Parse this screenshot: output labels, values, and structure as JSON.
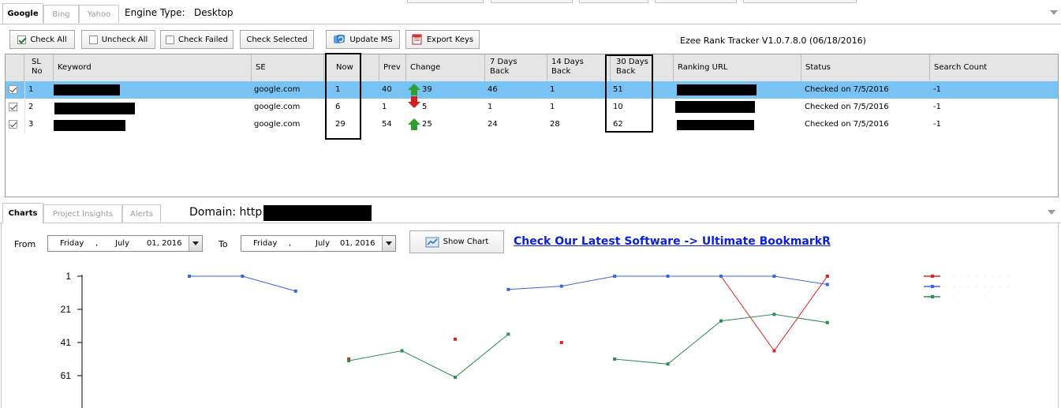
{
  "engine_tabs": [
    {
      "label": "Google",
      "active": true
    },
    {
      "label": "Bing",
      "active": false
    },
    {
      "label": "Yahoo",
      "active": false
    }
  ],
  "engine_type_label": "Engine Type:",
  "engine_type_value": "Desktop",
  "toolbar": {
    "check_all": "Check All",
    "uncheck_all": "Uncheck All",
    "check_failed": "Check Failed",
    "check_selected": "Check Selected",
    "update_ms": "Update MS",
    "export_keys": "Export Keys"
  },
  "version": "Ezee Rank Tracker V1.0.7.8.0 (06/18/2016)",
  "grid": {
    "headers": {
      "sl_no": "SL No",
      "keyword": "Keyword",
      "se": "SE",
      "now": "Now",
      "prev": "Prev",
      "change": "Change",
      "d7": "7 Days Back",
      "d14": "14 Days Back",
      "d30": "30 Days Back",
      "ranking_url": "Ranking URL",
      "status": "Status",
      "search_count": "Search Count"
    },
    "rows": [
      {
        "sl": "1",
        "se": "google.com",
        "now": "1",
        "prev": "40",
        "change": "39",
        "change_dir": "up",
        "d7": "46",
        "d14": "1",
        "d30": "51",
        "status": "Checked on 7/5/2016",
        "count": "-1",
        "checked": true,
        "selected": true
      },
      {
        "sl": "2",
        "se": "google.com",
        "now": "6",
        "prev": "1",
        "change": "5",
        "change_dir": "down",
        "d7": "1",
        "d14": "1",
        "d30": "10",
        "status": "Checked on 7/5/2016",
        "count": "-1",
        "checked": true,
        "selected": false
      },
      {
        "sl": "3",
        "se": "google.com",
        "now": "29",
        "prev": "54",
        "change": "25",
        "change_dir": "up",
        "d7": "24",
        "d14": "28",
        "d30": "62",
        "status": "Checked on 7/5/2016",
        "count": "-1",
        "checked": true,
        "selected": false
      }
    ]
  },
  "bottom_tabs": [
    {
      "label": "Charts",
      "active": true
    },
    {
      "label": "Project Insights",
      "active": false
    },
    {
      "label": "Alerts",
      "active": false
    }
  ],
  "domain_label": "Domain: http:",
  "from_label": "From",
  "to_label": "To",
  "from_date": {
    "day": "Friday",
    "sep": ",",
    "month": "July",
    "date": "01, 2016"
  },
  "to_date": {
    "day": "Friday",
    "sep": ",",
    "month": "July",
    "date": "01, 2016"
  },
  "show_chart": "Show Chart",
  "promo_link": "Check Our Latest Software -> Ultimate BookmarkR",
  "chart_data": {
    "type": "line",
    "yticks": [
      1,
      21,
      41,
      61
    ],
    "ylim": [
      1,
      80
    ],
    "y_inverted": true,
    "x_count": 13,
    "series": [
      {
        "color": "#e02020",
        "values": [
          null,
          null,
          null,
          51,
          null,
          39,
          null,
          41,
          null,
          null,
          1,
          46,
          1
        ]
      },
      {
        "color": "#3a66db",
        "values": [
          1,
          1,
          10,
          null,
          null,
          null,
          9,
          7,
          1,
          1,
          1,
          1,
          6
        ]
      },
      {
        "color": "#2e8b57",
        "values": [
          null,
          null,
          null,
          52,
          46,
          62,
          36,
          null,
          51,
          54,
          28,
          24,
          29
        ]
      }
    ]
  },
  "legend_colors": [
    "#e02020",
    "#3a66db",
    "#2e8b57"
  ]
}
